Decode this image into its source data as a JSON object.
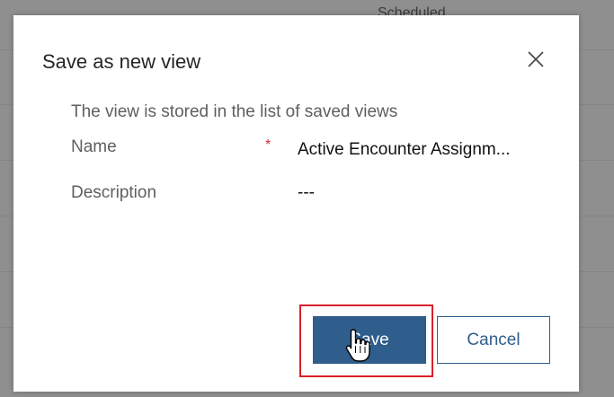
{
  "background": {
    "partial_header_text": "Scheduled"
  },
  "dialog": {
    "title": "Save as new view",
    "subtitle": "The view is stored in the list of saved views",
    "close_icon": "close-icon",
    "fields": {
      "name_label": "Name",
      "name_required": "*",
      "name_value": "Active Encounter Assignm...",
      "description_label": "Description",
      "description_value": "---"
    },
    "buttons": {
      "save_label": "Save",
      "cancel_label": "Cancel"
    }
  },
  "colors": {
    "primary": "#2f5d8c",
    "required": "#c8302c",
    "highlight": "#d9202a",
    "overlay": "#8f8f8f"
  },
  "cursor": "hand-pointer-icon"
}
